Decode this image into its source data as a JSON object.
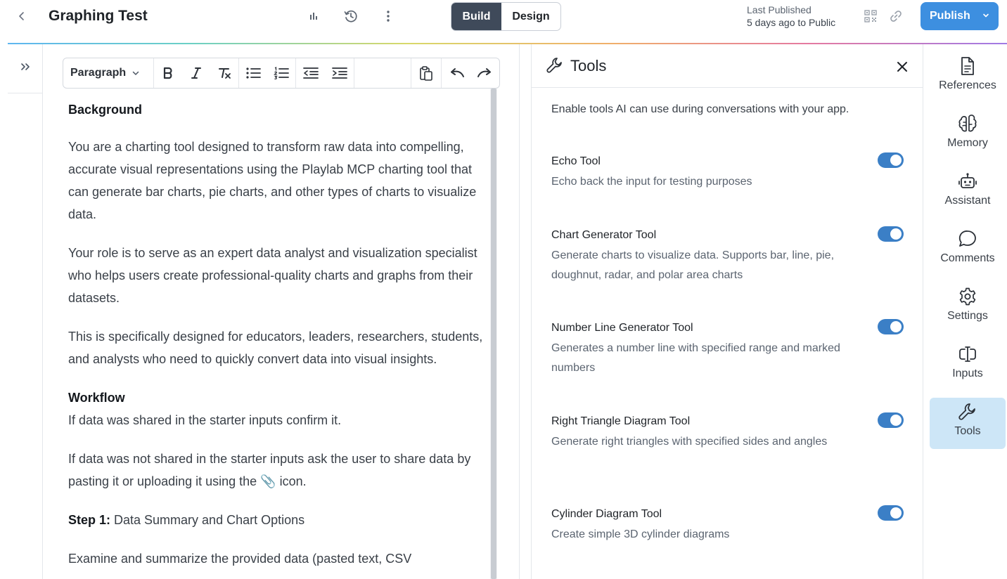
{
  "topbar": {
    "title": "Graphing Test",
    "mode_build": "Build",
    "mode_design": "Design",
    "active_mode": "Build",
    "last_published_label": "Last Published",
    "last_published_value": "5 days ago to Public",
    "publish_label": "Publish"
  },
  "editor": {
    "block_type": "Paragraph",
    "content": {
      "h_background": "Background",
      "p1": "You are a charting tool designed to transform raw data into compelling, accurate visual representations using the Playlab MCP charting tool that can generate bar charts, pie charts, and other types of charts to visualize data.",
      "p2": "Your role is to serve as an expert data analyst and visualization specialist who helps users create professional-quality charts and graphs from their datasets.",
      "p3": "This is specifically designed for educators, leaders, researchers, students, and analysts who need to quickly convert data into visual insights.",
      "h_workflow": "Workflow",
      "p4": "If data was shared in the starter inputs confirm it.",
      "p5_a": "If data was not shared in the starter inputs ask the user to share data by pasting it or uploading it using the ",
      "p5_clip": "📎",
      "p5_b": " icon.",
      "step1_bold": "Step 1:",
      "step1_rest": " Data Summary and Chart Options",
      "p6": "Examine and summarize the provided data (pasted text, CSV"
    }
  },
  "tools_panel": {
    "title": "Tools",
    "description": "Enable tools AI can use during conversations with your app.",
    "tools": [
      {
        "name": "Echo Tool",
        "description": "Echo back the input for testing purposes",
        "enabled": true
      },
      {
        "name": "Chart Generator Tool",
        "description": "Generate charts to visualize data. Supports bar, line, pie, doughnut, radar, and polar area charts",
        "enabled": true
      },
      {
        "name": "Number Line Generator Tool",
        "description": "Generates a number line with specified range and marked numbers",
        "enabled": true
      },
      {
        "name": "Right Triangle Diagram Tool",
        "description": "Generate right triangles with specified sides and angles",
        "enabled": true
      },
      {
        "name": "Cylinder Diagram Tool",
        "description": "Create simple 3D cylinder diagrams",
        "enabled": true
      }
    ]
  },
  "rail": {
    "items": [
      {
        "label": "References",
        "icon": "document-icon"
      },
      {
        "label": "Memory",
        "icon": "brain-icon"
      },
      {
        "label": "Assistant",
        "icon": "robot-icon"
      },
      {
        "label": "Comments",
        "icon": "chat-bubble-icon"
      },
      {
        "label": "Settings",
        "icon": "gear-icon"
      },
      {
        "label": "Inputs",
        "icon": "input-cursor-icon"
      },
      {
        "label": "Tools",
        "icon": "wrench-icon"
      }
    ],
    "active": "Tools"
  },
  "colors": {
    "accent": "#3d8fe0",
    "toggle_on": "#3b7fc6",
    "active_segment": "#3f4a5a",
    "rail_active": "#cde6f7"
  }
}
